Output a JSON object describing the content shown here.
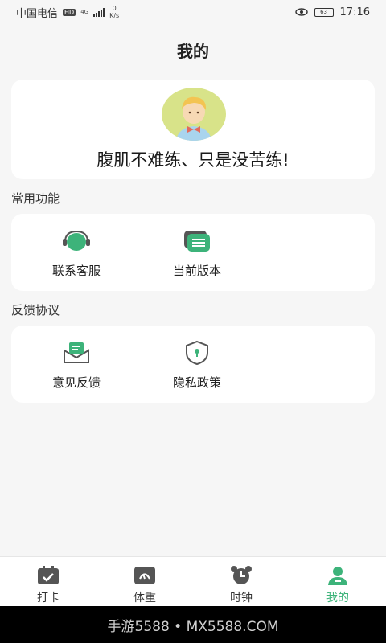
{
  "status": {
    "carrier": "中国电信",
    "hd": "HD",
    "network": "4G",
    "speed_value": "0",
    "speed_unit": "K/s",
    "battery": "63",
    "time": "17:16"
  },
  "page": {
    "title": "我的"
  },
  "profile": {
    "motto": "腹肌不难练、只是没苦练!"
  },
  "sections": {
    "common": {
      "label": "常用功能",
      "items": [
        {
          "label": "联系客服",
          "icon": "headset-icon"
        },
        {
          "label": "当前版本",
          "icon": "version-icon"
        }
      ]
    },
    "feedback": {
      "label": "反馈协议",
      "items": [
        {
          "label": "意见反馈",
          "icon": "mail-icon"
        },
        {
          "label": "隐私政策",
          "icon": "shield-icon"
        }
      ]
    }
  },
  "tabs": [
    {
      "label": "打卡",
      "icon": "calendar-check-icon"
    },
    {
      "label": "体重",
      "icon": "scale-icon"
    },
    {
      "label": "时钟",
      "icon": "alarm-clock-icon"
    },
    {
      "label": "我的",
      "icon": "user-icon",
      "active": true
    }
  ],
  "watermark": "手游5588 • MX5588.COM",
  "colors": {
    "accent": "#3db37a",
    "background": "#f6f6f6",
    "card": "#ffffff"
  }
}
